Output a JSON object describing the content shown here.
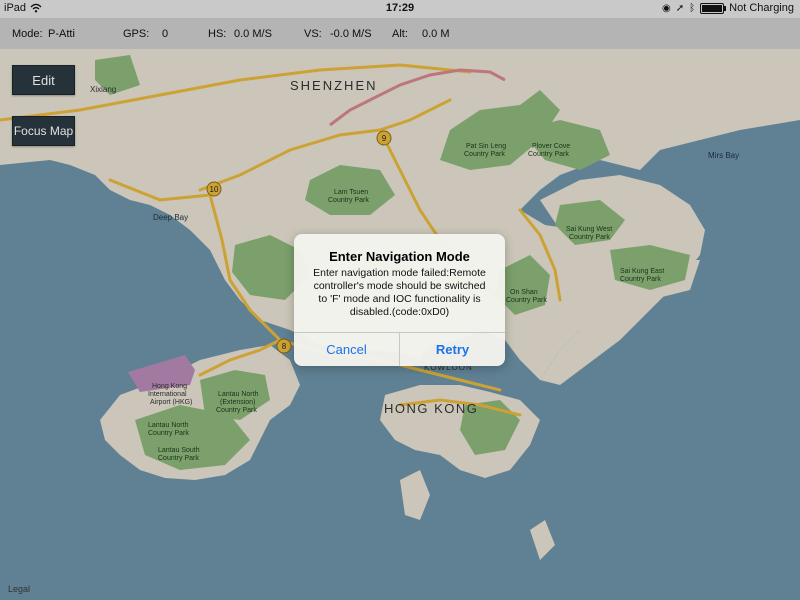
{
  "statusbar": {
    "device": "iPad",
    "time": "17:29",
    "charging": "Not Charging",
    "icons": [
      "wifi-icon",
      "location-icon",
      "bluetooth-icon",
      "battery-icon"
    ]
  },
  "telemetry": {
    "mode_label": "Mode:",
    "mode_value": "P-Atti",
    "gps_label": "GPS:",
    "gps_value": "0",
    "hs_label": "HS:",
    "hs_value": "0.0 M/S",
    "vs_label": "VS:",
    "vs_value": "-0.0 M/S",
    "alt_label": "Alt:",
    "alt_value": "0.0 M"
  },
  "buttons": {
    "edit": "Edit",
    "focus_map": "Focus Map"
  },
  "map": {
    "labels": {
      "shenzhen": "SHENZHEN",
      "xixiang": "Xixiang",
      "deep_bay": "Deep Bay",
      "mirs_bay": "Mirs Bay",
      "pat_sin_leng": "Pat Sin Leng",
      "pat_sin_leng_2": "Country Park",
      "plover_cove": "Plover Cove",
      "plover_cove_2": "Country Park",
      "lam_tsuen": "Lam Tsuen",
      "lam_tsuen_2": "Country Park",
      "sai_kung_west": "Sai Kung West",
      "sai_kung_west_2": "Country Park",
      "sai_kung_east": "Sai Kung East",
      "sai_kung_east_2": "Country Park",
      "ma_on_shan": "On Shan",
      "ma_on_shan_2": "Country Park",
      "airport": "Hong Kong",
      "airport_2": "International",
      "airport_3": "Airport (HKG)",
      "lantau_north_ext": "Lantau North",
      "lantau_north_ext_2": "(Extension)",
      "lantau_north_ext_3": "Country Park",
      "lantau_north": "Lantau North",
      "lantau_north_2": "Country Park",
      "lantau_south": "Lantau South",
      "lantau_south_2": "Country Park",
      "kowloon": "KOWLOON",
      "hong_kong": "HONG KONG",
      "route_9": "9",
      "route_10": "10",
      "route_8": "8"
    },
    "colors": {
      "water": "#6d93a8",
      "land": "#e7e2d3",
      "park": "#8db77a",
      "road": "#e9b93c",
      "border": "#d9868c",
      "airport": "#b98ab7"
    }
  },
  "dialog": {
    "title": "Enter Navigation Mode",
    "message_line1": "Enter navigation mode failed:Remote",
    "message_line2": "controller's mode should be switched",
    "message_line3": "to 'F' mode and IOC functionality is",
    "message_line4": "disabled.(code:0xD0)",
    "cancel": "Cancel",
    "retry": "Retry"
  },
  "legal": "Legal"
}
